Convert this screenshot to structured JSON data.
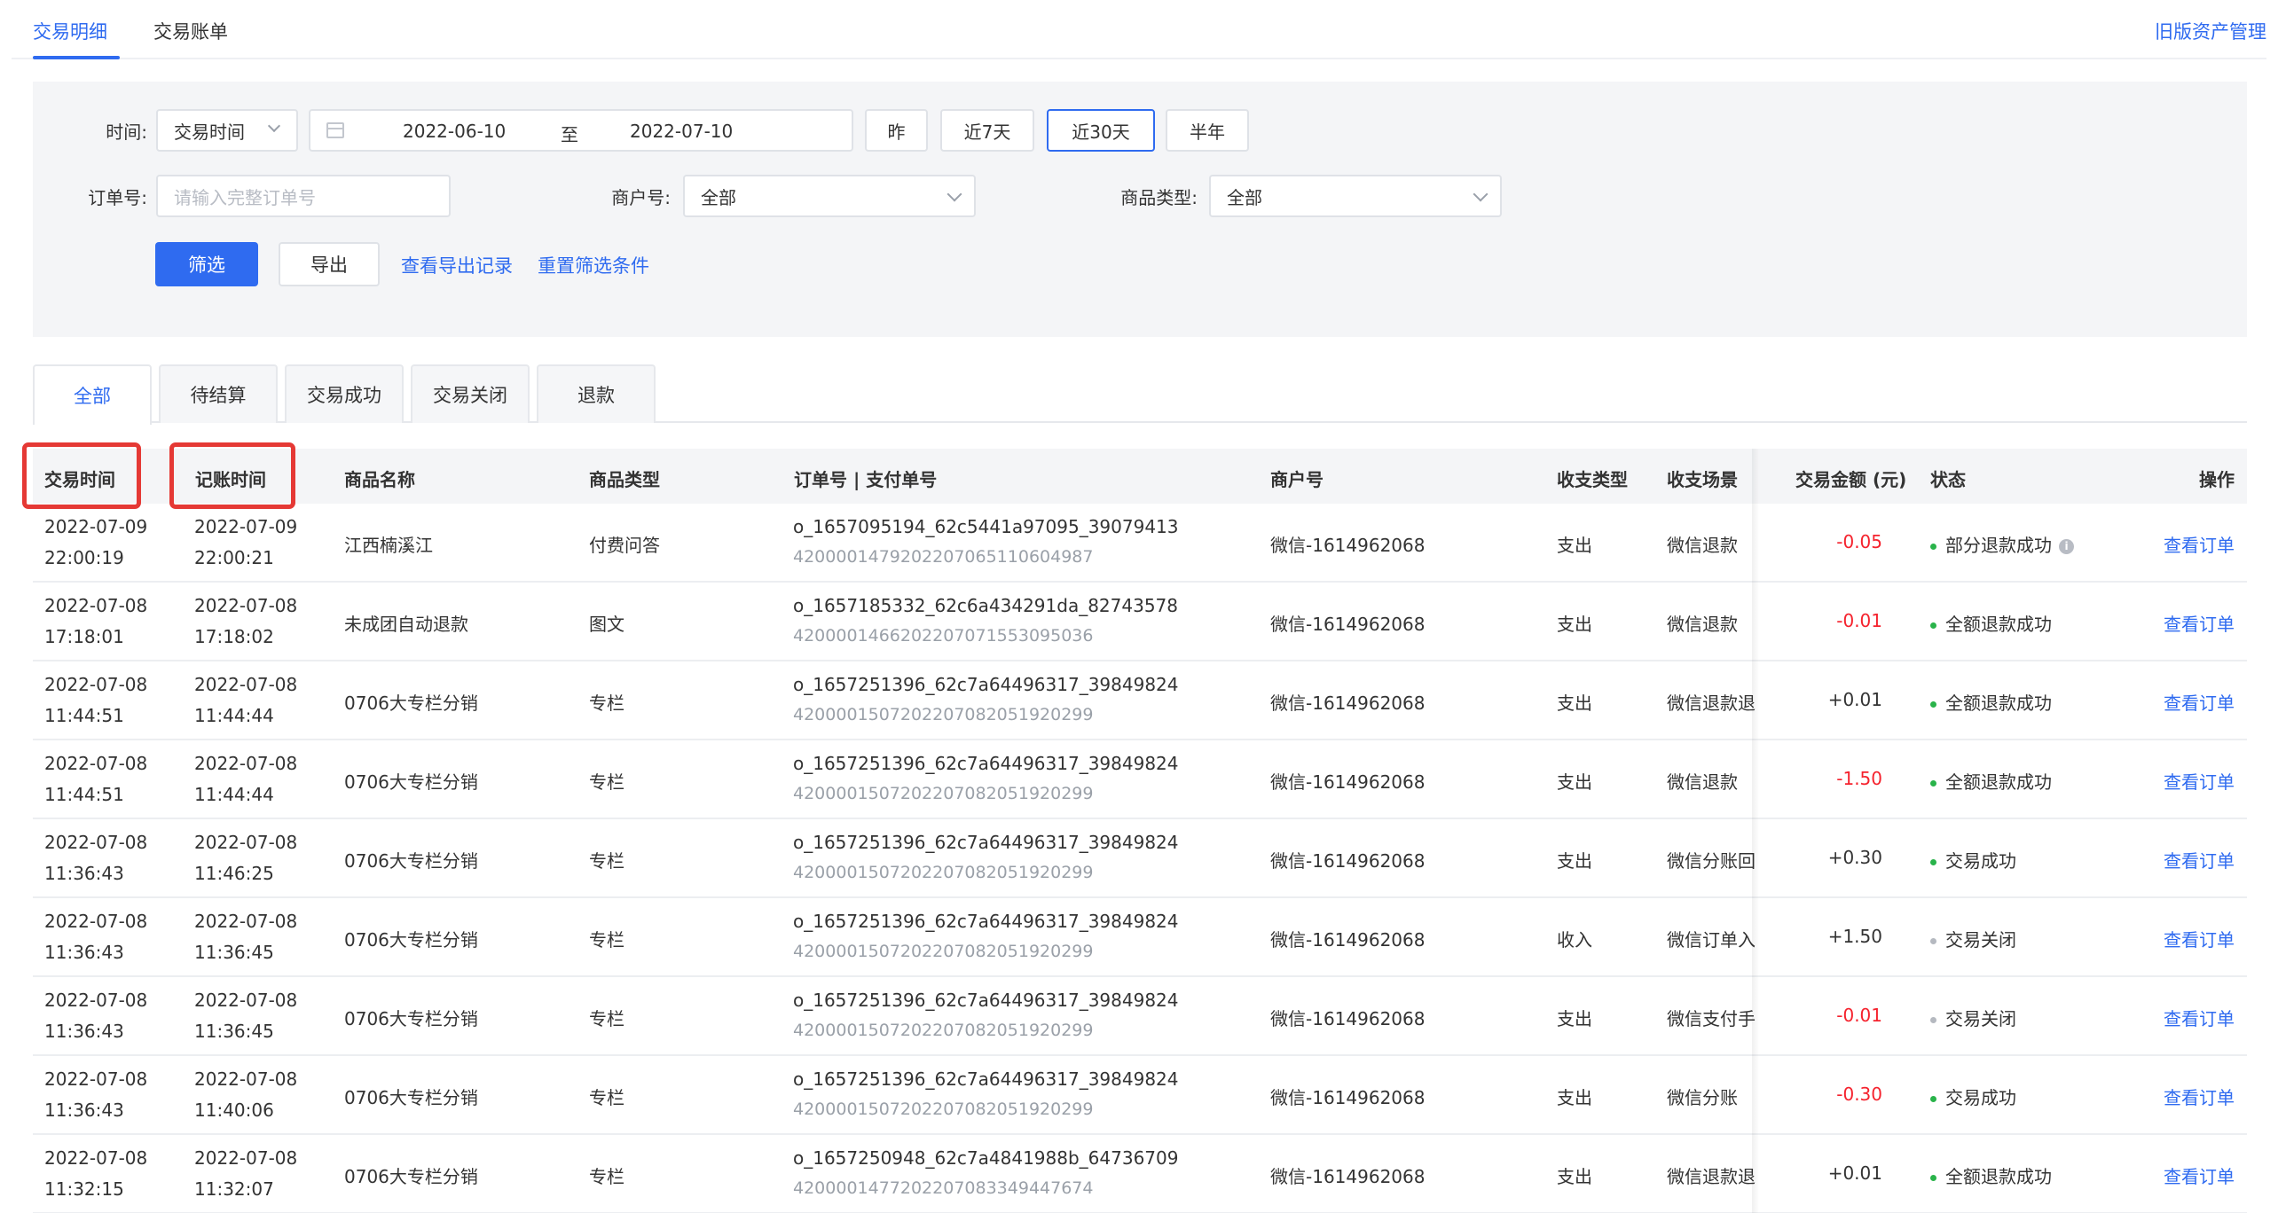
{
  "top_tabs": [
    {
      "label": "交易明细",
      "active": true
    },
    {
      "label": "交易账单",
      "active": false
    }
  ],
  "old_asset_link": "旧版资产管理",
  "filters": {
    "time_label": "时间:",
    "time_type": "交易时间",
    "date_start": "2022-06-10",
    "date_separator": "至",
    "date_end": "2022-07-10",
    "quick_ranges": [
      "昨",
      "近7天",
      "近30天",
      "半年"
    ],
    "quick_active": "近30天",
    "order_label": "订单号:",
    "order_placeholder": "请输入完整订单号",
    "merchant_label": "商户号:",
    "merchant_value": "全部",
    "product_type_label": "商品类型:",
    "product_type_value": "全部",
    "filter_button": "筛选",
    "export_button": "导出",
    "view_export_link": "查看导出记录",
    "reset_link": "重置筛选条件"
  },
  "status_tabs": [
    {
      "label": "全部",
      "active": true
    },
    {
      "label": "待结算",
      "active": false
    },
    {
      "label": "交易成功",
      "active": false
    },
    {
      "label": "交易关闭",
      "active": false
    },
    {
      "label": "退款",
      "active": false
    }
  ],
  "columns": [
    "交易时间",
    "记账时间",
    "商品名称",
    "商品类型",
    "订单号 | 支付单号",
    "商户号",
    "收支类型",
    "收支场景",
    "交易金额 (元)",
    "状态",
    "操作"
  ],
  "accent_colors": {
    "primary": "#2f6bf0",
    "negative": "#f5222d",
    "success_dot": "#29b34a",
    "closed_dot": "#b5b9c0",
    "highlight": "#e53935"
  },
  "rows": [
    {
      "trade_date": "2022-07-09",
      "trade_time": "22:00:19",
      "book_date": "2022-07-09",
      "book_time": "22:00:21",
      "product": "江西楠溪江",
      "type": "付费问答",
      "order_no": "o_1657095194_62c5441a97095_39079413",
      "pay_no": "4200001479202207065110604987",
      "merchant": "微信-1614962068",
      "io_type": "支出",
      "scene": "微信退款",
      "amount": "-0.05",
      "amount_sign": "neg",
      "status": "部分退款成功",
      "status_dot": "green",
      "info": "i",
      "action": "查看订单"
    },
    {
      "trade_date": "2022-07-08",
      "trade_time": "17:18:01",
      "book_date": "2022-07-08",
      "book_time": "17:18:02",
      "product": "未成团自动退款",
      "type": "图文",
      "order_no": "o_1657185332_62c6a434291da_82743578",
      "pay_no": "4200001466202207071553095036",
      "merchant": "微信-1614962068",
      "io_type": "支出",
      "scene": "微信退款",
      "amount": "-0.01",
      "amount_sign": "neg",
      "status": "全额退款成功",
      "status_dot": "green",
      "info": "",
      "action": "查看订单"
    },
    {
      "trade_date": "2022-07-08",
      "trade_time": "11:44:51",
      "book_date": "2022-07-08",
      "book_time": "11:44:44",
      "product": "0706大专栏分销",
      "type": "专栏",
      "order_no": "o_1657251396_62c7a64496317_39849824",
      "pay_no": "4200001507202207082051920299",
      "merchant": "微信-1614962068",
      "io_type": "支出",
      "scene": "微信退款退",
      "amount": "+0.01",
      "amount_sign": "pos",
      "status": "全额退款成功",
      "status_dot": "green",
      "info": "",
      "action": "查看订单"
    },
    {
      "trade_date": "2022-07-08",
      "trade_time": "11:44:51",
      "book_date": "2022-07-08",
      "book_time": "11:44:44",
      "product": "0706大专栏分销",
      "type": "专栏",
      "order_no": "o_1657251396_62c7a64496317_39849824",
      "pay_no": "4200001507202207082051920299",
      "merchant": "微信-1614962068",
      "io_type": "支出",
      "scene": "微信退款",
      "amount": "-1.50",
      "amount_sign": "neg",
      "status": "全额退款成功",
      "status_dot": "green",
      "info": "",
      "action": "查看订单"
    },
    {
      "trade_date": "2022-07-08",
      "trade_time": "11:36:43",
      "book_date": "2022-07-08",
      "book_time": "11:46:25",
      "product": "0706大专栏分销",
      "type": "专栏",
      "order_no": "o_1657251396_62c7a64496317_39849824",
      "pay_no": "4200001507202207082051920299",
      "merchant": "微信-1614962068",
      "io_type": "支出",
      "scene": "微信分账回",
      "amount": "+0.30",
      "amount_sign": "pos",
      "status": "交易成功",
      "status_dot": "green",
      "info": "",
      "action": "查看订单"
    },
    {
      "trade_date": "2022-07-08",
      "trade_time": "11:36:43",
      "book_date": "2022-07-08",
      "book_time": "11:36:45",
      "product": "0706大专栏分销",
      "type": "专栏",
      "order_no": "o_1657251396_62c7a64496317_39849824",
      "pay_no": "4200001507202207082051920299",
      "merchant": "微信-1614962068",
      "io_type": "收入",
      "scene": "微信订单入",
      "amount": "+1.50",
      "amount_sign": "pos",
      "status": "交易关闭",
      "status_dot": "grey",
      "info": "",
      "action": "查看订单"
    },
    {
      "trade_date": "2022-07-08",
      "trade_time": "11:36:43",
      "book_date": "2022-07-08",
      "book_time": "11:36:45",
      "product": "0706大专栏分销",
      "type": "专栏",
      "order_no": "o_1657251396_62c7a64496317_39849824",
      "pay_no": "4200001507202207082051920299",
      "merchant": "微信-1614962068",
      "io_type": "支出",
      "scene": "微信支付手",
      "amount": "-0.01",
      "amount_sign": "neg",
      "status": "交易关闭",
      "status_dot": "grey",
      "info": "",
      "action": "查看订单"
    },
    {
      "trade_date": "2022-07-08",
      "trade_time": "11:36:43",
      "book_date": "2022-07-08",
      "book_time": "11:40:06",
      "product": "0706大专栏分销",
      "type": "专栏",
      "order_no": "o_1657251396_62c7a64496317_39849824",
      "pay_no": "4200001507202207082051920299",
      "merchant": "微信-1614962068",
      "io_type": "支出",
      "scene": "微信分账",
      "amount": "-0.30",
      "amount_sign": "neg",
      "status": "交易成功",
      "status_dot": "green",
      "info": "",
      "action": "查看订单"
    },
    {
      "trade_date": "2022-07-08",
      "trade_time": "11:32:15",
      "book_date": "2022-07-08",
      "book_time": "11:32:07",
      "product": "0706大专栏分销",
      "type": "专栏",
      "order_no": "o_1657250948_62c7a4841988b_64736709",
      "pay_no": "4200001477202207083349447674",
      "merchant": "微信-1614962068",
      "io_type": "支出",
      "scene": "微信退款退",
      "amount": "+0.01",
      "amount_sign": "pos",
      "status": "全额退款成功",
      "status_dot": "green",
      "info": "",
      "action": "查看订单"
    }
  ]
}
